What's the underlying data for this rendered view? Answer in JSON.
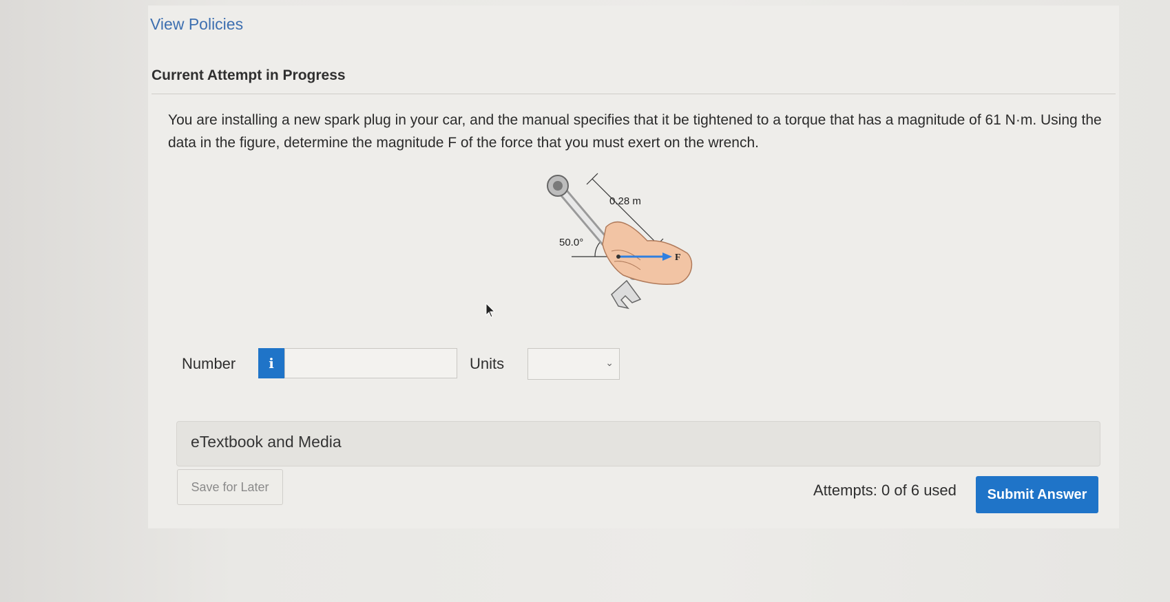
{
  "header": {
    "view_policies": "View Policies",
    "attempt_title": "Current Attempt in Progress"
  },
  "question": {
    "text": "You are installing a new spark plug in your car, and the manual specifies that it be tightened to a torque that has a magnitude of 61 N·m. Using the data in the figure, determine the magnitude F of the force that you must exert on the wrench."
  },
  "figure": {
    "length_label": "0.28 m",
    "angle_label": "50.0°",
    "force_label": "F"
  },
  "answer": {
    "number_label": "Number",
    "info_icon": "i",
    "number_value": "",
    "units_label": "Units",
    "units_selected": ""
  },
  "resources": {
    "etextbook_label": "eTextbook and Media"
  },
  "footer": {
    "save_label": "Save for Later",
    "attempts_text": "Attempts: 0 of 6 used",
    "submit_label": "Submit Answer"
  },
  "colors": {
    "link": "#3d6fb0",
    "primary_button": "#1f74c8",
    "force_arrow": "#2f7fe0"
  }
}
